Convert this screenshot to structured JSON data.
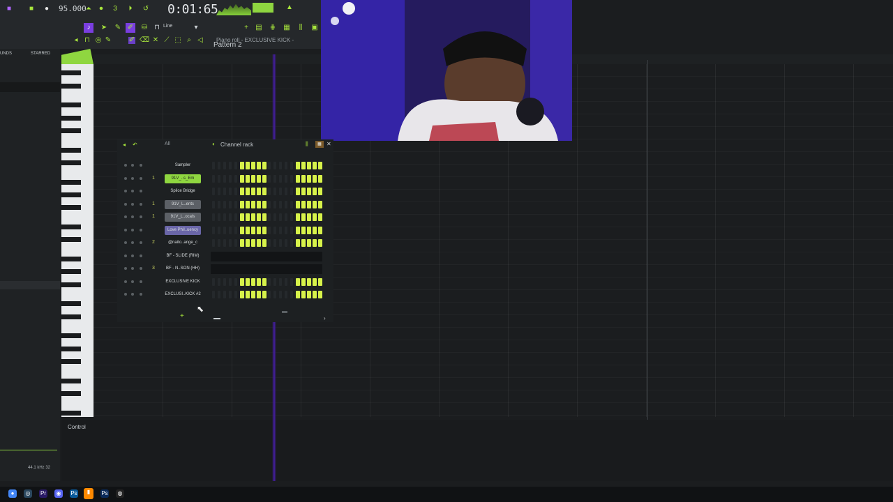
{
  "toolbar": {
    "tempo": "95.000",
    "time_display": "0:01:65",
    "pattern": "Pattern 2",
    "snap": "Line",
    "piano_roll_title": "Piano roll - EXCLUSIVE KICK -"
  },
  "browser": {
    "tab_sounds": "UNDS",
    "tab_starred": "STARRED",
    "status": "44.1 kHz 32"
  },
  "channel_rack": {
    "title": "Channel rack",
    "filter": "All",
    "channels": [
      {
        "num": "",
        "name": "Sampler",
        "style": "plain",
        "steps": [
          0,
          0,
          0,
          0,
          0,
          1,
          1,
          1,
          1,
          1,
          0,
          0,
          0,
          0,
          0,
          1,
          1,
          1,
          1,
          1
        ]
      },
      {
        "num": "1",
        "name": "91V_..s_Em",
        "style": "green",
        "steps": [
          0,
          0,
          0,
          0,
          0,
          1,
          1,
          1,
          1,
          1,
          0,
          0,
          0,
          0,
          0,
          1,
          1,
          1,
          1,
          1
        ]
      },
      {
        "num": "",
        "name": "Splice Bridge",
        "style": "plain",
        "steps": [
          0,
          0,
          0,
          0,
          0,
          1,
          1,
          1,
          1,
          1,
          0,
          0,
          0,
          0,
          0,
          1,
          1,
          1,
          1,
          1
        ]
      },
      {
        "num": "1",
        "name": "91V_L..ents",
        "style": "grey",
        "steps": [
          0,
          0,
          0,
          0,
          0,
          1,
          1,
          1,
          1,
          1,
          0,
          0,
          0,
          0,
          0,
          1,
          1,
          1,
          1,
          1
        ]
      },
      {
        "num": "1",
        "name": "91V_L..ocals",
        "style": "grey",
        "steps": [
          0,
          0,
          0,
          0,
          0,
          1,
          1,
          1,
          1,
          1,
          0,
          0,
          0,
          0,
          0,
          1,
          1,
          1,
          1,
          1
        ]
      },
      {
        "num": "",
        "name": "Love Phil..uency",
        "style": "purple",
        "steps": [
          0,
          0,
          0,
          0,
          0,
          1,
          1,
          1,
          1,
          1,
          0,
          0,
          0,
          0,
          0,
          1,
          1,
          1,
          1,
          1
        ]
      },
      {
        "num": "2",
        "name": "@naito..ange_c",
        "style": "plain",
        "steps": [
          0,
          0,
          0,
          0,
          0,
          1,
          1,
          1,
          1,
          1,
          0,
          0,
          0,
          0,
          0,
          1,
          1,
          1,
          1,
          1
        ]
      },
      {
        "num": "",
        "name": "BF - SLIDE (RIM)",
        "style": "plain",
        "steps": []
      },
      {
        "num": "3",
        "name": "BF - N..SON (HH)",
        "style": "plain",
        "steps": []
      },
      {
        "num": "",
        "name": "EXCLUSIVE KICK",
        "style": "plain",
        "steps": [
          0,
          0,
          0,
          0,
          0,
          1,
          1,
          1,
          1,
          1,
          0,
          0,
          0,
          0,
          0,
          1,
          1,
          1,
          1,
          1
        ]
      },
      {
        "num": "",
        "name": "EXCLUSI..KICK #2",
        "style": "plain",
        "steps": [
          0,
          0,
          0,
          0,
          0,
          1,
          1,
          1,
          1,
          1,
          0,
          0,
          0,
          0,
          0,
          1,
          1,
          1,
          1,
          1
        ]
      }
    ]
  },
  "piano_roll": {
    "control_label": "Control"
  },
  "colors": {
    "accent": "#a8e63c",
    "step_on": "#d7f24a",
    "playhead": "#4d24b0"
  },
  "taskbar": {
    "icons": [
      "chrome-icon",
      "steam-icon",
      "premiere-icon",
      "discord-icon",
      "store-icon",
      "fl-studio-icon",
      "photoshop-icon",
      "obs-icon"
    ]
  }
}
